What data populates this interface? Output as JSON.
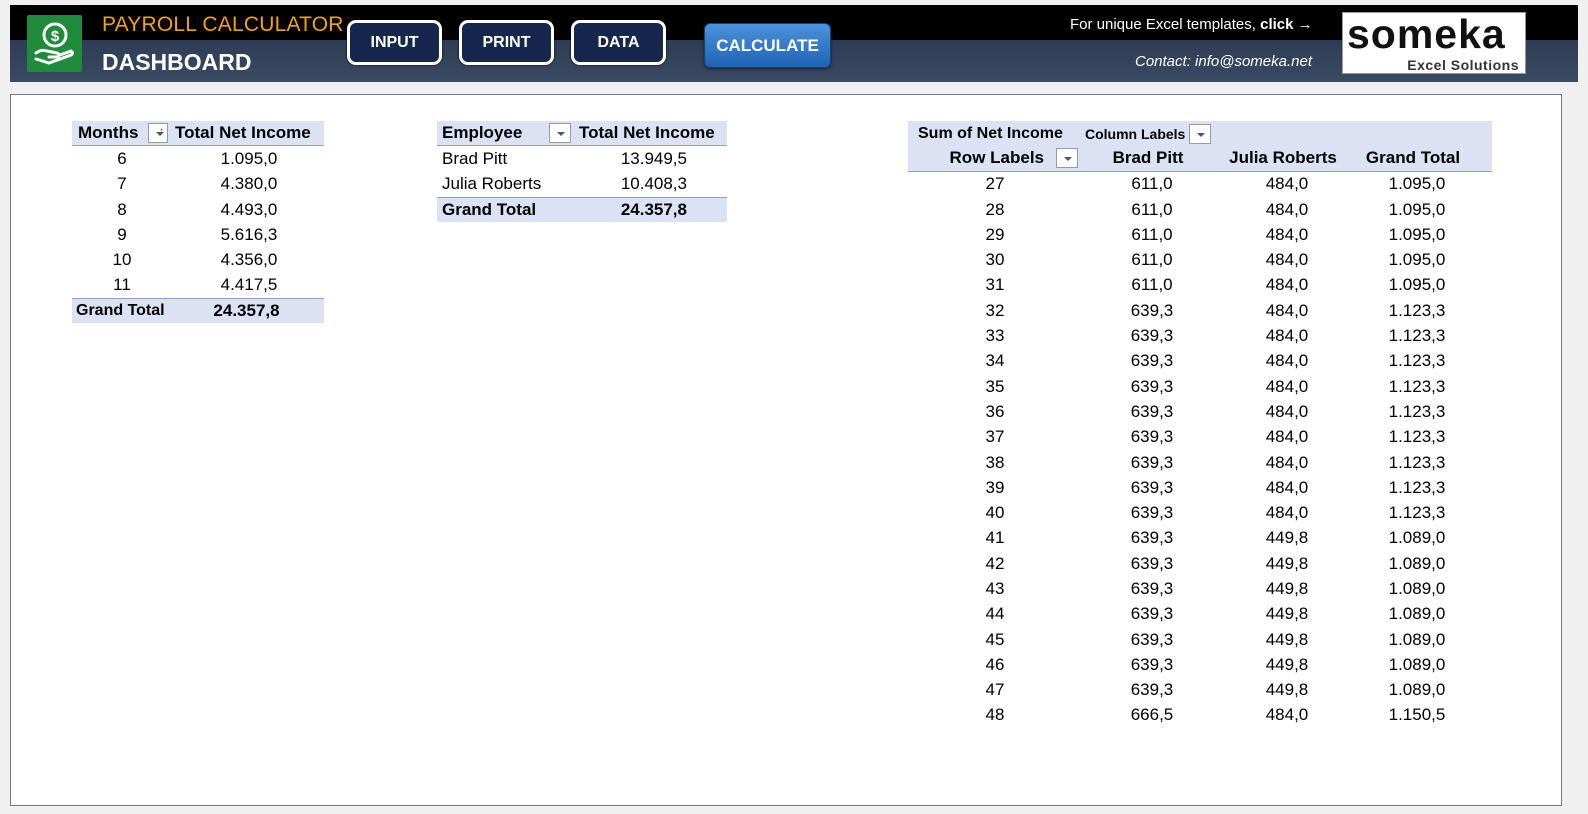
{
  "header": {
    "title": "PAYROLL CALCULATOR",
    "subtitle": "DASHBOARD",
    "logo_icon": "money-hand-icon",
    "nav": {
      "input_label": "INPUT",
      "print_label": "PRINT",
      "data_label": "DATA",
      "calculate_label": "CALCULATE"
    },
    "promo_text": "For unique Excel templates,",
    "promo_click": "click",
    "promo_arrow": "→",
    "contact": "Contact: info@someka.net",
    "brand_name": "someka",
    "brand_tagline": "Excel Solutions"
  },
  "months_pivot": {
    "headers": [
      "Months",
      "Total Net Income"
    ],
    "rows": [
      {
        "month": "6",
        "value": "1.095,0"
      },
      {
        "month": "7",
        "value": "4.380,0"
      },
      {
        "month": "8",
        "value": "4.493,0"
      },
      {
        "month": "9",
        "value": "5.616,3"
      },
      {
        "month": "10",
        "value": "4.356,0"
      },
      {
        "month": "11",
        "value": "4.417,5"
      }
    ],
    "total_label": "Grand Total",
    "total_value": "24.357,8"
  },
  "employee_pivot": {
    "headers": [
      "Employee",
      "Total Net Income"
    ],
    "rows": [
      {
        "name": "Brad Pitt",
        "value": "13.949,5"
      },
      {
        "name": "Julia Roberts",
        "value": "10.408,3"
      }
    ],
    "total_label": "Grand Total",
    "total_value": "24.357,8"
  },
  "week_pivot": {
    "value_label": "Sum of Net Income",
    "column_labels": "Column Labels",
    "row_labels": "Row Labels",
    "columns": [
      "Brad Pitt",
      "Julia Roberts",
      "Grand Total"
    ],
    "rows": [
      [
        "27",
        "611,0",
        "484,0",
        "1.095,0"
      ],
      [
        "28",
        "611,0",
        "484,0",
        "1.095,0"
      ],
      [
        "29",
        "611,0",
        "484,0",
        "1.095,0"
      ],
      [
        "30",
        "611,0",
        "484,0",
        "1.095,0"
      ],
      [
        "31",
        "611,0",
        "484,0",
        "1.095,0"
      ],
      [
        "32",
        "639,3",
        "484,0",
        "1.123,3"
      ],
      [
        "33",
        "639,3",
        "484,0",
        "1.123,3"
      ],
      [
        "34",
        "639,3",
        "484,0",
        "1.123,3"
      ],
      [
        "35",
        "639,3",
        "484,0",
        "1.123,3"
      ],
      [
        "36",
        "639,3",
        "484,0",
        "1.123,3"
      ],
      [
        "37",
        "639,3",
        "484,0",
        "1.123,3"
      ],
      [
        "38",
        "639,3",
        "484,0",
        "1.123,3"
      ],
      [
        "39",
        "639,3",
        "484,0",
        "1.123,3"
      ],
      [
        "40",
        "639,3",
        "484,0",
        "1.123,3"
      ],
      [
        "41",
        "639,3",
        "449,8",
        "1.089,0"
      ],
      [
        "42",
        "639,3",
        "449,8",
        "1.089,0"
      ],
      [
        "43",
        "639,3",
        "449,8",
        "1.089,0"
      ],
      [
        "44",
        "639,3",
        "449,8",
        "1.089,0"
      ],
      [
        "45",
        "639,3",
        "449,8",
        "1.089,0"
      ],
      [
        "46",
        "639,3",
        "449,8",
        "1.089,0"
      ],
      [
        "47",
        "639,3",
        "449,8",
        "1.089,0"
      ],
      [
        "48",
        "666,5",
        "484,0",
        "1.150,5"
      ]
    ]
  }
}
